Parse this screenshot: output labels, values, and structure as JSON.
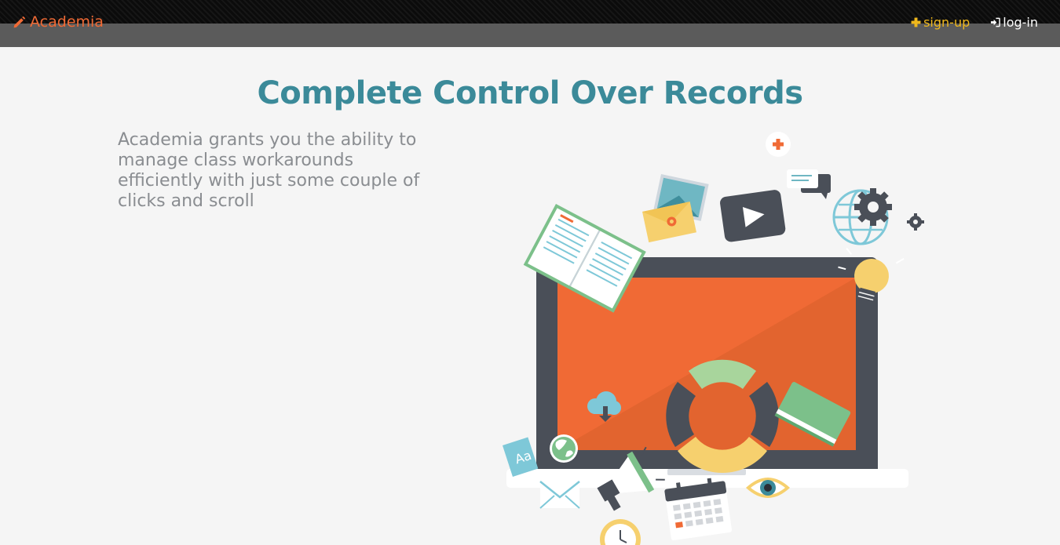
{
  "navbar": {
    "brand": "Academia",
    "brand_icon": "pencil-icon",
    "signup_label": "sign-up",
    "signup_icon": "plus-icon",
    "login_label": "log-in",
    "login_icon": "sign-in-icon"
  },
  "hero": {
    "title": "Complete Control Over Records",
    "description": "Academia grants you the ability to manage class workarounds efficiently with just some couple of clicks and scroll"
  },
  "illustration": {
    "icons": [
      "laptop-icon",
      "open-book-icon",
      "image-icon",
      "photo-envelope-icon",
      "video-play-icon",
      "chat-bubble-icon",
      "plus-badge-icon",
      "globe-icon",
      "gear-icon",
      "lightbulb-icon",
      "donut-chart-icon",
      "green-book-icon",
      "cloud-download-icon",
      "earth-icon",
      "dictionary-icon",
      "megaphone-icon",
      "mail-icon",
      "calendar-icon",
      "eye-icon",
      "clock-icon"
    ]
  },
  "colors": {
    "accent": "#f06a35",
    "signup": "#f0b81c",
    "title": "#3b8a99",
    "navbar_bg": "#5b5b5b",
    "page_bg": "#f5f5f5"
  }
}
